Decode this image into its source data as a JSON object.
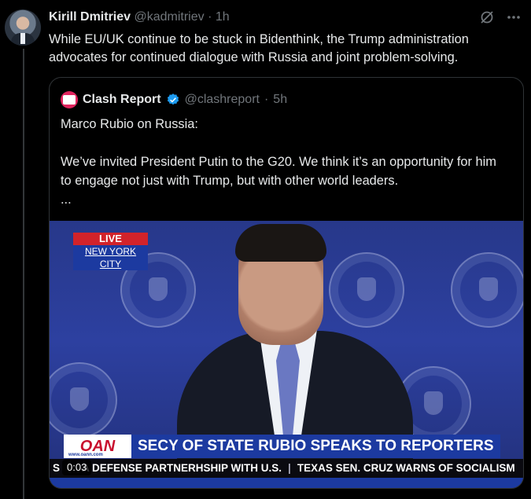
{
  "tweet": {
    "author_name": "Kirill Dmitriev",
    "handle": "@kadmitriev",
    "separator": "·",
    "time": "1h",
    "text": "While EU/UK continue to be stuck in Bidenthink, the Trump administration advocates for continued dialogue with Russia and joint problem-solving.",
    "icons": {
      "grok": "grok-icon",
      "more": "more-icon"
    }
  },
  "quote": {
    "author_name": "Clash Report",
    "handle": "@clashreport",
    "separator": "·",
    "time": "5h",
    "verified": true,
    "line1": "Marco Rubio on Russia:",
    "line2": "We’ve invited President Putin to the G20. We think it’s an opportunity for him to engage not just with Trump, but with other world leaders.",
    "line3": "..."
  },
  "video": {
    "live_label": "LIVE",
    "location": "NEW YORK CITY",
    "network": "OAN",
    "network_url": "www.oann.com",
    "headline": "SECY OF STATE RUBIO SPEAKS TO REPORTERS",
    "ticker_1": "S",
    "ticker_2": "A DEFENSE PARTNERHSHIP WITH U.S.",
    "ticker_3": "TEXAS SEN. CRUZ WARNS OF SOCIALISM",
    "time": "0:03"
  },
  "colors": {
    "accent": "#1d9bf0",
    "oan_red": "#c8102e",
    "oan_blue": "#1c3aa0"
  }
}
